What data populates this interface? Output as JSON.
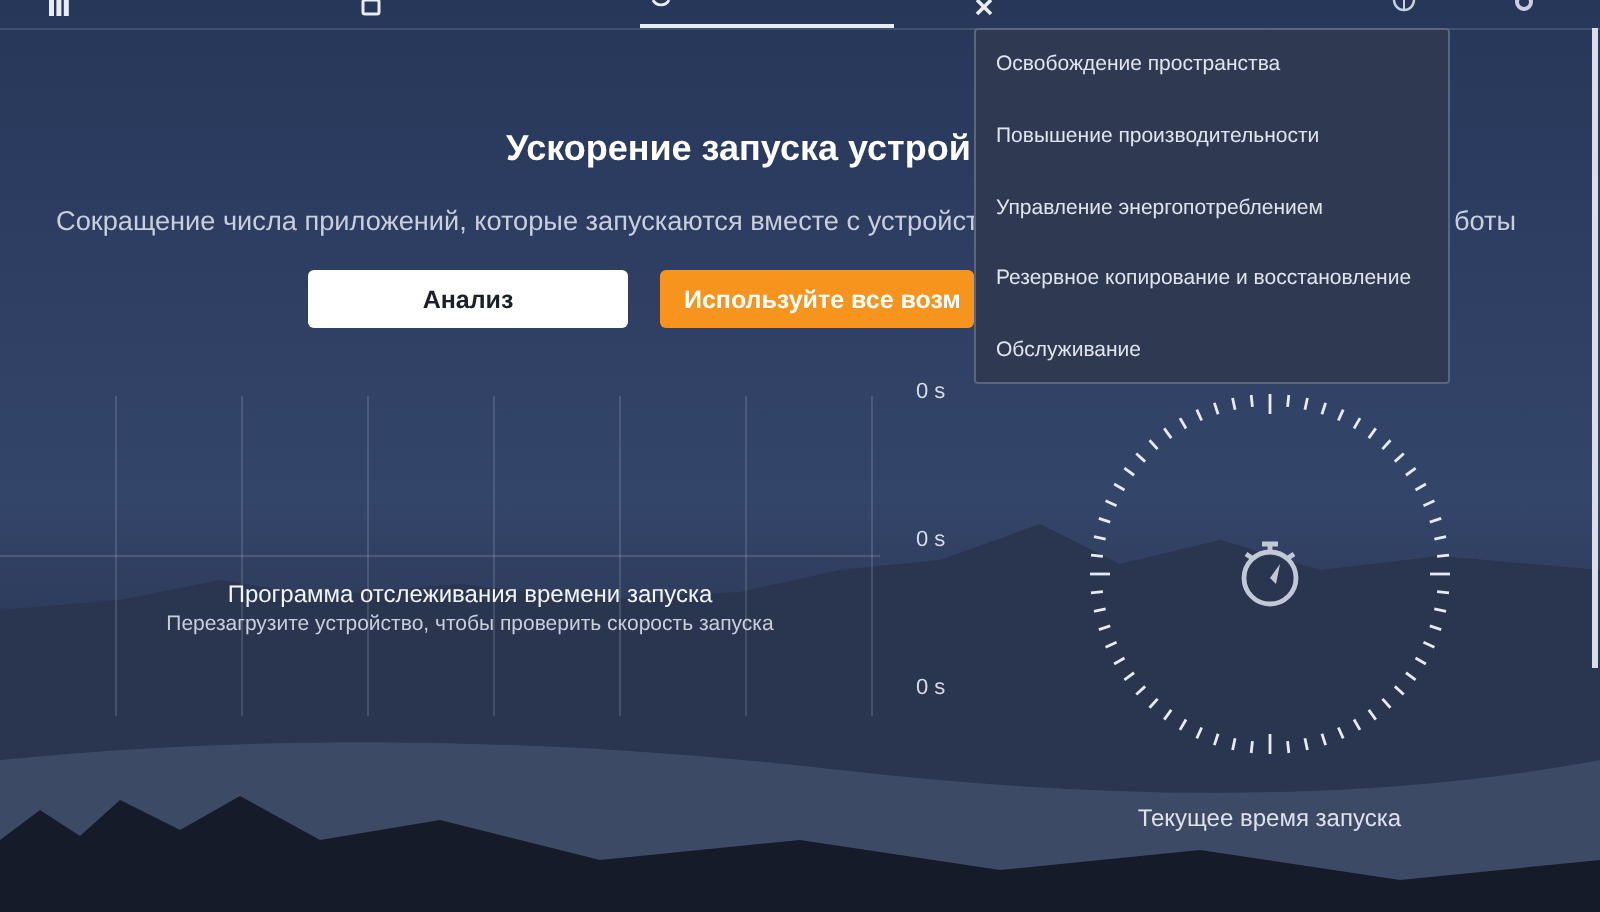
{
  "nav": {
    "tabs": [
      {
        "selected": false
      },
      {
        "selected": false
      },
      {
        "selected": true
      },
      {
        "selected": false
      }
    ]
  },
  "hero": {
    "title": "Ускорение запуска устрой",
    "subtitle_start": "Сокращение числа приложений, которые запускаются вместе с устройст",
    "subtitle_end": "боты",
    "buttons": [
      {
        "label": "Анализ",
        "kind": "secondary"
      },
      {
        "label": "Используйте все возм",
        "kind": "primary"
      }
    ]
  },
  "tools_menu": {
    "items": [
      "Освобождение пространства",
      "Повышение производительности",
      "Управление энергопотреблением",
      "Резервное копирование и восстановление",
      "Обслуживание"
    ]
  },
  "boot_chart": {
    "axis_labels": [
      "0 s",
      "0 s",
      "0 s"
    ],
    "title": "Программа отслеживания времени запуска",
    "hint": "Перезагрузите устройство, чтобы проверить скорость запуска"
  },
  "boot_gauge": {
    "caption": "Текущее время запуска"
  }
}
